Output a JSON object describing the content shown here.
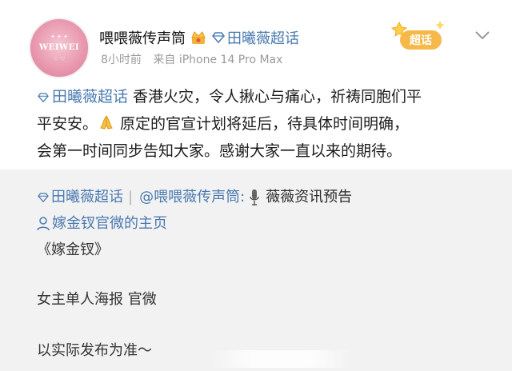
{
  "header": {
    "avatar_logo": "WEIWEI",
    "username": "喂喂薇传声筒",
    "topic_link": "田曦薇超话",
    "time": "8小时前",
    "source": "来自 iPhone 14 Pro Max",
    "badge_label": "超话"
  },
  "post": {
    "topic": "田曦薇超话",
    "line1_rest": " 香港火灾，令人揪心与痛心，祈祷同胞们平",
    "line2_a": "平安安。",
    "line2_b": " 原定的官宣计划将延后，待具体时间明确，",
    "line3": "会第一时间同步告知大家。感谢大家一直以来的期待。"
  },
  "repost": {
    "topic": "田曦薇超话",
    "separator": "|",
    "mention": "@喂喂薇传声筒:",
    "channel": "薇薇资讯预告",
    "homepage": "嫁金钗官微的主页",
    "title_line": "《嫁金钗》",
    "poster_line": "女主单人海报 官微",
    "note_line": "以实际发布为准～"
  },
  "colors": {
    "link": "#4a7ab0",
    "meta": "#9a9a9a",
    "repost_bg": "#f2f2f2",
    "badge": "#f5a623"
  }
}
